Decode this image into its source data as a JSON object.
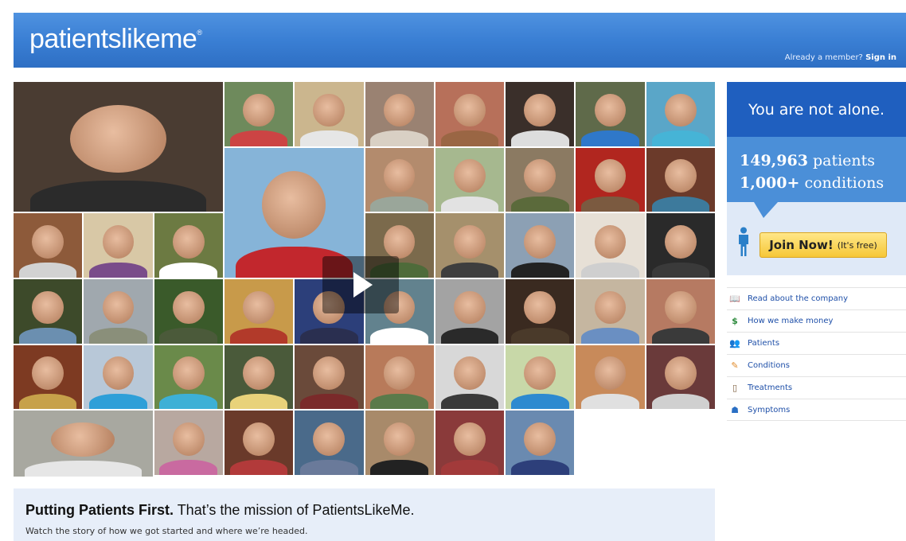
{
  "header": {
    "logo_text": "patientslikeme",
    "logo_mark": "®",
    "member_prompt": "Already a member?",
    "sign_in_label": "Sign in",
    "bar_color": "#3a7fd4"
  },
  "mosaic": {
    "play_icon": "play-icon",
    "tiles": [
      {
        "bg": "#4a3c32",
        "shirt": "#2b2b2b"
      },
      {
        "bg": "#6e8a5c",
        "shirt": "#c44"
      },
      {
        "bg": "#cbb68e",
        "shirt": "#e6e6e6"
      },
      {
        "bg": "#9a8272",
        "shirt": "#d9d0c4"
      },
      {
        "bg": "#b7705a",
        "shirt": "#9a6644"
      },
      {
        "bg": "#3a2f2a",
        "shirt": "#ddd"
      },
      {
        "bg": "#5f6a4a",
        "shirt": "#2f78c9"
      },
      {
        "bg": "#5aa6c8",
        "shirt": "#46b4d6"
      },
      {
        "bg": "#86b4d8",
        "shirt": "#c2272d"
      },
      {
        "bg": "#b38b6d",
        "shirt": "#9aa69a"
      },
      {
        "bg": "#a6b88f",
        "shirt": "#e2e2e2"
      },
      {
        "bg": "#8b7a62",
        "shirt": "#5b6a3b"
      },
      {
        "bg": "#b1261f",
        "shirt": "#7b5a40"
      },
      {
        "bg": "#6b3a2a",
        "shirt": "#3d7a9c"
      },
      {
        "bg": "#8d5a3a",
        "shirt": "#d2d2d2"
      },
      {
        "bg": "#d8c8a6",
        "shirt": "#7a4c8a"
      },
      {
        "bg": "#6c7a42",
        "shirt": "#fff"
      },
      {
        "bg": "#7b6a4c",
        "shirt": "#4e6b3a"
      },
      {
        "bg": "#a5906c",
        "shirt": "#3e3e3e"
      },
      {
        "bg": "#8ca0b4",
        "shirt": "#222"
      },
      {
        "bg": "#e7e0d6",
        "shirt": "#cfcfcf"
      },
      {
        "bg": "#2a2a2a",
        "shirt": "#3a3a3a"
      },
      {
        "bg": "#3d4a2a",
        "shirt": "#6b8fb0"
      },
      {
        "bg": "#a0a8ae",
        "shirt": "#8a8f7a"
      },
      {
        "bg": "#3a5a2a",
        "shirt": "#4b5a3a"
      },
      {
        "bg": "#c89a4a",
        "shirt": "#b23a2a"
      },
      {
        "bg": "#2c3f7a",
        "shirt": "#2a2f50"
      },
      {
        "bg": "#62828e",
        "shirt": "#fff"
      },
      {
        "bg": "#a3a3a3",
        "shirt": "#2a2a2a"
      },
      {
        "bg": "#3a2a20",
        "shirt": "#4a3a2a"
      },
      {
        "bg": "#c5b6a0",
        "shirt": "#6a8fc2"
      },
      {
        "bg": "#b67a62",
        "shirt": "#3a3a3a"
      },
      {
        "bg": "#7d3a22",
        "shirt": "#c7a14a"
      },
      {
        "bg": "#b8c8d8",
        "shirt": "#2e9fd8"
      },
      {
        "bg": "#6a8a4a",
        "shirt": "#3db0d6"
      },
      {
        "bg": "#4a5a3a",
        "shirt": "#e8d27a"
      },
      {
        "bg": "#6a4a3a",
        "shirt": "#7a2a2a"
      },
      {
        "bg": "#b87a5a",
        "shirt": "#5a7a4a"
      },
      {
        "bg": "#d8d8d8",
        "shirt": "#3a3a3a"
      },
      {
        "bg": "#c8d8a8",
        "shirt": "#2d8ad0"
      },
      {
        "bg": "#c88a5a",
        "shirt": "#e0e0e0"
      },
      {
        "bg": "#6a3a3a",
        "shirt": "#d0d0d0"
      },
      {
        "bg": "#a8a8a0",
        "shirt": "#e6e6e6"
      },
      {
        "bg": "#b8a8a0",
        "shirt": "#c96aa0"
      },
      {
        "bg": "#6a3a2a",
        "shirt": "#b23a3a"
      },
      {
        "bg": "#4a6a8a",
        "shirt": "#6a7a9a"
      },
      {
        "bg": "#a88a6a",
        "shirt": "#222"
      },
      {
        "bg": "#8a3a3a",
        "shirt": "#a23a3a"
      },
      {
        "bg": "#6a8ab0",
        "shirt": "#2d3f7a"
      }
    ]
  },
  "mission": {
    "headline_bold": "Putting Patients First.",
    "headline_rest": " That’s the mission of PatientsLikeMe.",
    "subtext": "Watch the story of how we got started and where we’re headed.",
    "bg_color": "#e7eef9"
  },
  "stats": {
    "title": "You are not alone.",
    "patients_count": "149,963",
    "patients_label": " patients",
    "conditions_count": "1,000+",
    "conditions_label": " conditions",
    "join_label": "Join Now!",
    "join_note": "(It's free)",
    "person_icon": "person-icon"
  },
  "nav": {
    "items": [
      {
        "label": "Read about the company",
        "icon": "book-icon",
        "glyph": "📖",
        "color": "#3b6fb6"
      },
      {
        "label": "How we make money",
        "icon": "dollar-icon",
        "glyph": "$",
        "color": "#2e8b3e"
      },
      {
        "label": "Patients",
        "icon": "people-icon",
        "glyph": "👥",
        "color": "#d88a1a"
      },
      {
        "label": "Conditions",
        "icon": "bandage-icon",
        "glyph": "✎",
        "color": "#e08a2a"
      },
      {
        "label": "Treatments",
        "icon": "pill-bottle-icon",
        "glyph": "▯",
        "color": "#7a5a3a"
      },
      {
        "label": "Symptoms",
        "icon": "person-pain-icon",
        "glyph": "☗",
        "color": "#2a6fc4"
      }
    ]
  }
}
